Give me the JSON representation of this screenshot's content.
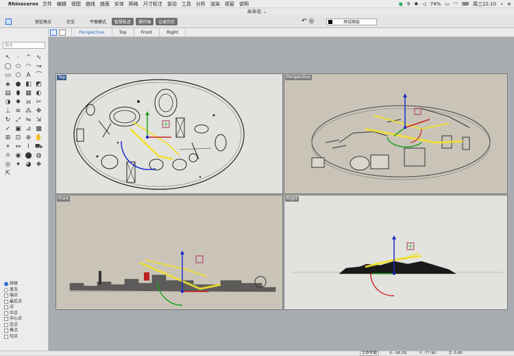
{
  "menubar": {
    "app": "Rhinoceros",
    "items": [
      "文件",
      "编辑",
      "视图",
      "曲线",
      "曲面",
      "实体",
      "网格",
      "尺寸标注",
      "变动",
      "工具",
      "分析",
      "渲染",
      "视窗",
      "说明"
    ],
    "battery": "74%",
    "clock": "周三22:10",
    "wechat_count": "9"
  },
  "window": {
    "title": "未命名"
  },
  "toolbar": {
    "snap": "锁定格点",
    "ortho": "正交",
    "planar": "平面模式",
    "smarttrack": "智慧轨迹",
    "gumball": "操作轴",
    "history": "记录历史"
  },
  "layer": {
    "name": "预设图层"
  },
  "command": {
    "placeholder": "指令"
  },
  "tabs": [
    "Perspective",
    "Top",
    "Front",
    "Right"
  ],
  "viewports": {
    "top": "Top",
    "perspective": "Perspective",
    "front": "Front",
    "right": "Right"
  },
  "options": {
    "persistent": "持续",
    "once": "单次",
    "snaps": [
      "端点",
      "最近点",
      "点",
      "中点",
      "中心点",
      "交点",
      "垂点",
      "切点"
    ]
  },
  "status": {
    "cplane": "工作平面",
    "x": "X: -56.59",
    "y": "Y: -77.90",
    "z": "Z: 0.00"
  },
  "colors": {
    "accent": "#2a6fd6",
    "bg_light": "#e2e3df",
    "bg_warm": "#cac4b8"
  }
}
